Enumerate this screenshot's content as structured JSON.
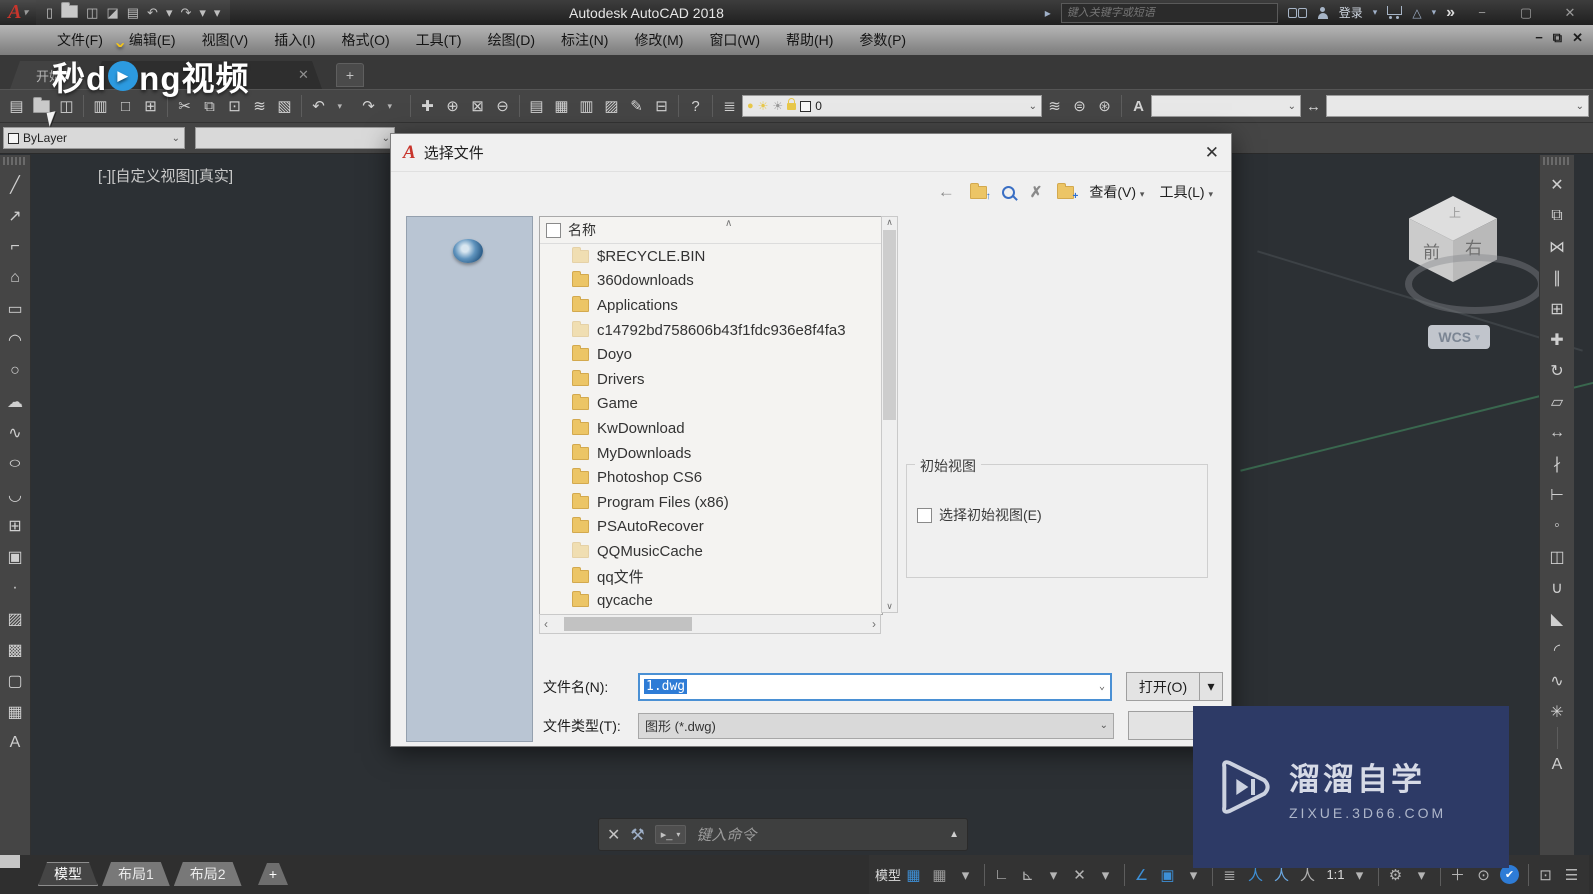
{
  "titlebar": {
    "title": "Autodesk AutoCAD 2018",
    "search_placeholder": "键入关键字或短语",
    "signin_label": "登录",
    "qat_icons": [
      {
        "name": "new-file-icon",
        "glyph": "▯"
      },
      {
        "name": "open-file-icon",
        "folder": true
      },
      {
        "name": "save-icon",
        "glyph": "◫"
      },
      {
        "name": "save-as-icon",
        "glyph": "◪"
      },
      {
        "name": "plot-icon",
        "glyph": "▤"
      },
      {
        "name": "undo-icon",
        "glyph": "↶"
      },
      {
        "name": "qat-undo-dropdown",
        "glyph": "▾",
        "small": true
      },
      {
        "name": "redo-icon",
        "glyph": "↷"
      },
      {
        "name": "qat-redo-dropdown",
        "glyph": "▾",
        "small": true
      },
      {
        "name": "qat-customize-dropdown",
        "glyph": "▾",
        "small": true
      }
    ],
    "win_buttons": {
      "minimize": "−",
      "restore": "▢",
      "close": "✕"
    },
    "overflow_chevron": "»",
    "left_chevron": "▸",
    "a360_glyph": "△"
  },
  "menubar": {
    "items": [
      "文件(F)",
      "编辑(E)",
      "视图(V)",
      "插入(I)",
      "格式(O)",
      "工具(T)",
      "绘图(D)",
      "标注(N)",
      "修改(M)",
      "窗口(W)",
      "帮助(H)",
      "参数(P)"
    ],
    "win_controls": {
      "minimize": "−",
      "restore": "⧉",
      "close": "✕"
    }
  },
  "tabbar": {
    "start_label": "开始",
    "close_glyph": "✕",
    "new_tab_glyph": "+"
  },
  "watermark_top": {
    "pre": "秒d",
    "play": "▶",
    "post": "ng视频"
  },
  "toolbar_main": {
    "icons": [
      {
        "name": "new-icon",
        "glyph": "▤"
      },
      {
        "name": "open-icon",
        "folder": true
      },
      {
        "name": "save-icon",
        "glyph": "◫"
      },
      {
        "sep": true
      },
      {
        "name": "plot-icon",
        "glyph": "▥"
      },
      {
        "name": "plot-preview-icon",
        "glyph": "□"
      },
      {
        "name": "publish-icon",
        "glyph": "⊞"
      },
      {
        "sep": true
      },
      {
        "name": "cut-icon",
        "glyph": "✂"
      },
      {
        "name": "copy-icon",
        "glyph": "⧉"
      },
      {
        "name": "paste-icon",
        "glyph": "⊡"
      },
      {
        "name": "match-properties-icon",
        "glyph": "≋"
      },
      {
        "name": "block-editor-icon",
        "glyph": "▧"
      },
      {
        "sep": true
      },
      {
        "name": "undo-icon",
        "glyph": "↶"
      },
      {
        "name": "undo-dropdown",
        "glyph": "▾",
        "small": true
      },
      {
        "name": "redo-icon",
        "glyph": "↷"
      },
      {
        "name": "redo-dropdown",
        "glyph": "▾",
        "small": true
      },
      {
        "sep": true
      },
      {
        "name": "pan-icon",
        "glyph": "✚"
      },
      {
        "name": "zoom-realtime-icon",
        "glyph": "⊕"
      },
      {
        "name": "zoom-window-icon",
        "glyph": "⊠"
      },
      {
        "name": "zoom-previous-icon",
        "glyph": "⊖"
      },
      {
        "sep": true
      },
      {
        "name": "properties-icon",
        "glyph": "▤"
      },
      {
        "name": "designcenter-icon",
        "glyph": "▦"
      },
      {
        "name": "tool-palettes-icon",
        "glyph": "▥"
      },
      {
        "name": "sheet-set-manager-icon",
        "glyph": "▨"
      },
      {
        "name": "markup-set-manager-icon",
        "glyph": "✎"
      },
      {
        "name": "quick-calculator-icon",
        "glyph": "⊟"
      },
      {
        "sep": true
      },
      {
        "name": "help-icon",
        "glyph": "?"
      }
    ]
  },
  "layer_toolbar": {
    "current_layer": "0",
    "right_icons": [
      {
        "name": "layer-states-icon",
        "glyph": "≋"
      },
      {
        "name": "make-object-layer-current-icon",
        "glyph": "⊜"
      },
      {
        "name": "layer-previous-icon",
        "glyph": "⊛"
      }
    ],
    "text_style_icon": "A",
    "dim_style_icon": "↔"
  },
  "properties_toolbar": {
    "color_value": "ByLayer"
  },
  "viewport": {
    "label": "[-][自定义视图][真实]",
    "wcs": "WCS",
    "cube_front": "前",
    "cube_right": "右",
    "cube_top": "上"
  },
  "left_rail": [
    {
      "name": "line-icon",
      "glyph": "╱"
    },
    {
      "name": "construction-line-icon",
      "glyph": "↗"
    },
    {
      "name": "polyline-icon",
      "glyph": "⌐"
    },
    {
      "name": "polygon-icon",
      "glyph": "⌂"
    },
    {
      "name": "rectangle-icon",
      "glyph": "▭"
    },
    {
      "name": "arc-icon",
      "glyph": "◠"
    },
    {
      "name": "circle-icon",
      "glyph": "○"
    },
    {
      "name": "revision-cloud-icon",
      "glyph": "☁"
    },
    {
      "name": "spline-icon",
      "glyph": "∿"
    },
    {
      "name": "ellipse-icon",
      "glyph": "○",
      "stretch": true
    },
    {
      "name": "ellipse-arc-icon",
      "glyph": "◡"
    },
    {
      "name": "insert-block-icon",
      "glyph": "⊞"
    },
    {
      "name": "create-block-icon",
      "glyph": "▣"
    },
    {
      "name": "point-icon",
      "glyph": "∙"
    },
    {
      "name": "hatch-icon",
      "glyph": "▨"
    },
    {
      "name": "gradient-icon",
      "glyph": "▩"
    },
    {
      "name": "region-icon",
      "glyph": "▢"
    },
    {
      "name": "table-icon",
      "glyph": "▦"
    },
    {
      "name": "multiline-text-icon",
      "glyph": "A"
    }
  ],
  "right_rail": [
    {
      "name": "erase-icon",
      "glyph": "✕"
    },
    {
      "name": "copy-icon",
      "glyph": "⧉"
    },
    {
      "name": "mirror-icon",
      "glyph": "⋈"
    },
    {
      "name": "offset-icon",
      "glyph": "∥"
    },
    {
      "name": "array-icon",
      "glyph": "⊞"
    },
    {
      "name": "move-icon",
      "glyph": "✚"
    },
    {
      "name": "rotate-icon",
      "glyph": "↻"
    },
    {
      "name": "scale-icon",
      "glyph": "▱"
    },
    {
      "name": "stretch-icon",
      "glyph": "↔"
    },
    {
      "name": "trim-icon",
      "glyph": "∤"
    },
    {
      "name": "extend-icon",
      "glyph": "⊢"
    },
    {
      "name": "break-at-point-icon",
      "glyph": "◦"
    },
    {
      "name": "break-icon",
      "glyph": "◫"
    },
    {
      "name": "join-icon",
      "glyph": "∪"
    },
    {
      "name": "chamfer-icon",
      "glyph": "◣"
    },
    {
      "name": "fillet-icon",
      "glyph": "◜"
    },
    {
      "name": "blend-curves-icon",
      "glyph": "∿"
    },
    {
      "name": "explode-icon",
      "glyph": "✳"
    },
    {
      "sep": true
    },
    {
      "name": "spell-check-icon",
      "glyph": "A"
    }
  ],
  "dialog": {
    "title": "选择文件",
    "close_glyph": "✕",
    "toolbar": {
      "back_glyph": "←",
      "delete_glyph": "✗",
      "views_label": "查看(V)",
      "tools_label": "工具(L)",
      "dropdown_glyph": "▾"
    },
    "list": {
      "header": "名称",
      "sort_indicator": "∧",
      "up_arrow": "∧",
      "down_arrow": "∨",
      "left_arrow": "‹",
      "right_arrow": "›",
      "items": [
        {
          "name": "$RECYCLE.BIN",
          "hidden": true
        },
        {
          "name": "360downloads"
        },
        {
          "name": "Applications"
        },
        {
          "name": "c14792bd758606b43f1fdc936e8f4fa3",
          "hidden": true
        },
        {
          "name": "Doyo"
        },
        {
          "name": "Drivers"
        },
        {
          "name": "Game"
        },
        {
          "name": "KwDownload"
        },
        {
          "name": "MyDownloads"
        },
        {
          "name": "Photoshop CS6"
        },
        {
          "name": "Program Files (x86)"
        },
        {
          "name": "PSAutoRecover"
        },
        {
          "name": "QQMusicCache",
          "hidden": true
        },
        {
          "name": "qq文件"
        },
        {
          "name": "qycache"
        }
      ]
    },
    "initial_view": {
      "group_label": "初始视图",
      "checkbox_label": "选择初始视图(E)"
    },
    "filename": {
      "label": "文件名(N):",
      "value": "1.dwg"
    },
    "filetype": {
      "label": "文件类型(T):",
      "value": "图形 (*.dwg)"
    },
    "open_button": "打开(O)",
    "open_split_glyph": "▾"
  },
  "command_line": {
    "close_glyph": "✕",
    "wrench_glyph": "⚒",
    "prompt_glyph": "▸_",
    "prompt_dropdown": "▾",
    "placeholder": "键入命令",
    "up_glyph": "▲"
  },
  "statusbar": {
    "layout_tabs": [
      {
        "label": "模型",
        "active": true
      },
      {
        "label": "布局1"
      },
      {
        "label": "布局2"
      }
    ],
    "new_layout_glyph": "+",
    "icons": [
      {
        "name": "model-space-label",
        "label": "模型"
      },
      {
        "name": "grid-icon",
        "glyph": "▦",
        "color": "#3d8fd6"
      },
      {
        "name": "snap-icon",
        "glyph": "▦",
        "color": "#9a9a9a"
      },
      {
        "name": "snap-dropdown",
        "glyph": "▾",
        "small": true
      },
      {
        "sep": true
      },
      {
        "name": "ortho-icon",
        "glyph": "∟"
      },
      {
        "name": "polar-tracking-icon",
        "glyph": "⊾"
      },
      {
        "name": "polar-dropdown",
        "glyph": "▾",
        "small": true
      },
      {
        "name": "isometric-drafting-icon",
        "glyph": "✕"
      },
      {
        "name": "isodraft-dropdown",
        "glyph": "▾",
        "small": true
      },
      {
        "sep": true
      },
      {
        "name": "object-snap-tracking-icon",
        "glyph": "∠",
        "color": "#3d8fd6"
      },
      {
        "name": "object-snap-icon",
        "glyph": "▣",
        "color": "#3d8fd6"
      },
      {
        "name": "osnap-dropdown",
        "glyph": "▾",
        "small": true
      },
      {
        "sep": true
      },
      {
        "name": "lineweight-icon",
        "glyph": "≣"
      },
      {
        "name": "annotation-visibility-icon",
        "glyph": "人",
        "color": "#3d8fd6"
      },
      {
        "name": "autoscale-icon",
        "glyph": "人",
        "color": "#6aa7e0"
      },
      {
        "name": "annotation-scale-icon",
        "glyph": "人",
        "color": "#b0b0b0"
      },
      {
        "name": "annotation-scale-label",
        "label": "1:1"
      },
      {
        "name": "scale-dropdown",
        "glyph": "▾",
        "small": true
      },
      {
        "sep": true
      },
      {
        "name": "customization-gear-icon",
        "glyph": "⚙"
      },
      {
        "name": "gear-dropdown",
        "glyph": "▾",
        "small": true
      },
      {
        "sep": true
      },
      {
        "name": "plus-icon",
        "glyph": "＋"
      },
      {
        "name": "isolate-objects-icon",
        "glyph": "⊙"
      },
      {
        "name": "graphics-performance-icon",
        "glyph": "✔",
        "circle": true
      },
      {
        "sep": true
      },
      {
        "name": "clean-screen-icon",
        "glyph": "⊡"
      },
      {
        "name": "hamburger-menu-icon",
        "glyph": "☰"
      }
    ]
  },
  "watermark_bottom": {
    "title": "溜溜自学",
    "url": "ZIXUE.3D66.COM"
  }
}
